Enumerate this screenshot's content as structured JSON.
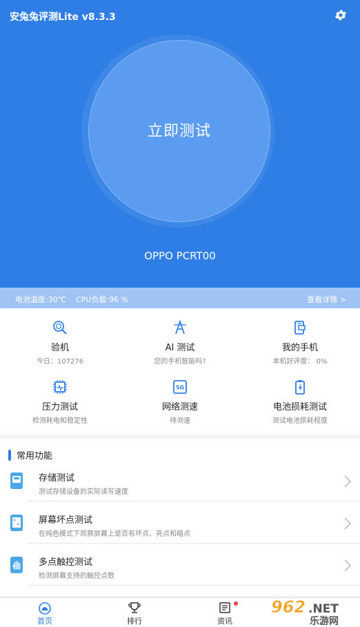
{
  "app": {
    "title": "安兔兔评测Lite v8.3.3"
  },
  "hero": {
    "test_button": "立即测试",
    "device": "OPPO PCRT00"
  },
  "status": {
    "battery_temp": "电池温度:30℃",
    "cpu_load": "CPU负载:96 %",
    "detail_link": "查看详情 >"
  },
  "grid": [
    {
      "title": "验机",
      "sub": "今日：107276",
      "icon": "magnifier-icon"
    },
    {
      "title": "AI 测试",
      "sub": "您的手机智能吗?",
      "icon": "ai-icon"
    },
    {
      "title": "我的手机",
      "sub": "本机好评度：  0%",
      "icon": "phone-info-icon"
    },
    {
      "title": "压力测试",
      "sub": "检测耗电和稳定性",
      "icon": "chip-icon"
    },
    {
      "title": "网络测速",
      "sub": "待测速",
      "icon": "5g-icon"
    },
    {
      "title": "电池损耗测试",
      "sub": "测试电池损耗程度",
      "icon": "battery-icon"
    }
  ],
  "common": {
    "title": "常用功能",
    "items": [
      {
        "title": "存储测试",
        "sub": "测试存储设备的实际读写速度",
        "icon": "storage-icon"
      },
      {
        "title": "屏幕坏点测试",
        "sub": "在纯色模式下观察屏幕上是否有坏点、亮点和暗点",
        "icon": "screen-icon"
      },
      {
        "title": "多点触控测试",
        "sub": "检测屏幕支持的触控点数",
        "icon": "touch-icon"
      }
    ]
  },
  "nav": {
    "home": "首页",
    "rank": "排行",
    "news": "资讯"
  },
  "watermark": {
    "text1": "962",
    "text2": ".NET",
    "text3": "乐游网"
  },
  "colors": {
    "primary": "#2f7ee6",
    "status_bar": "#9fc3f2",
    "badge": "#f04040"
  }
}
